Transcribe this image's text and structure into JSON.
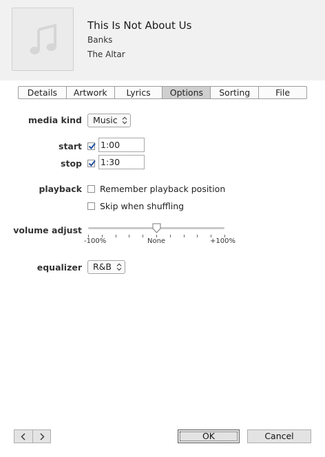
{
  "header": {
    "artwork_icon": "music-note-icon",
    "title": "This Is Not About Us",
    "artist": "Banks",
    "album": "The Altar"
  },
  "tabs": [
    {
      "label": "Details",
      "active": false
    },
    {
      "label": "Artwork",
      "active": false
    },
    {
      "label": "Lyrics",
      "active": false
    },
    {
      "label": "Options",
      "active": true
    },
    {
      "label": "Sorting",
      "active": false
    },
    {
      "label": "File",
      "active": false
    }
  ],
  "options": {
    "media_kind": {
      "label": "media kind",
      "value": "Music"
    },
    "start": {
      "label": "start",
      "checked": true,
      "value": "1:00"
    },
    "stop": {
      "label": "stop",
      "checked": true,
      "value": "1:30"
    },
    "playback": {
      "label": "playback",
      "remember": {
        "label": "Remember playback position",
        "checked": false
      },
      "skip": {
        "label": "Skip when shuffling",
        "checked": false
      }
    },
    "volume": {
      "label": "volume adjust",
      "min_label": "-100%",
      "mid_label": "None",
      "max_label": "+100%",
      "value_percent": 0
    },
    "equalizer": {
      "label": "equalizer",
      "value": "R&B"
    }
  },
  "footer": {
    "prev_icon": "chevron-left-icon",
    "next_icon": "chevron-right-icon",
    "ok_label": "OK",
    "cancel_label": "Cancel"
  },
  "colors": {
    "header_bg": "#f1f1f1",
    "active_tab": "#cfcfcf",
    "checkbox_check": "#1f4f9e"
  }
}
